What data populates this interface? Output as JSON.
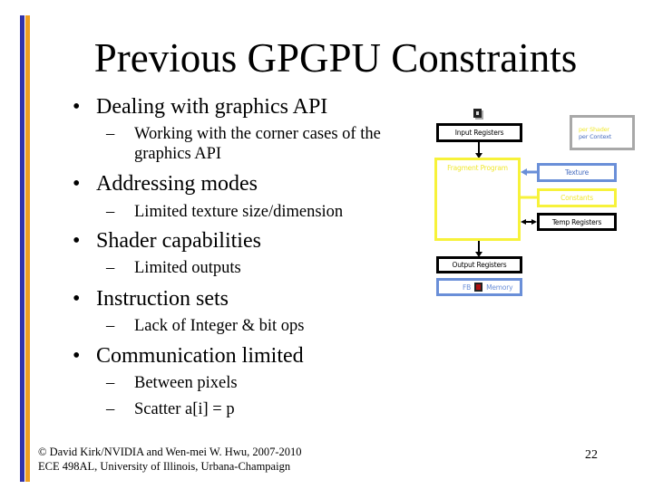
{
  "slide": {
    "title": "Previous GPGPU Constraints",
    "bullets": [
      {
        "text": "Dealing with graphics API",
        "sub": [
          "Working with the corner cases of the graphics API"
        ]
      },
      {
        "text": "Addressing modes",
        "sub": [
          "Limited texture size/dimension"
        ]
      },
      {
        "text": "Shader capabilities",
        "sub": [
          "Limited outputs"
        ]
      },
      {
        "text": "Instruction sets",
        "sub": [
          "Lack of Integer & bit ops"
        ]
      },
      {
        "text": "Communication limited",
        "sub": [
          "Between pixels",
          "Scatter  a[i] = p"
        ]
      }
    ],
    "bullet_glyph": "•",
    "dash_glyph": "–",
    "footer": {
      "line1": "© David Kirk/NVIDIA and Wen-mei W. Hwu, 2007-2010",
      "line2": "ECE 498AL, University of Illinois, Urbana-Champaign"
    },
    "page_number": "22"
  },
  "diagram": {
    "input_registers": "Input Registers",
    "fragment_program": "Fragment Program",
    "texture": "Texture",
    "constants": "Constants",
    "temp_registers": "Temp Registers",
    "output_registers": "Output Registers",
    "fb": "FB",
    "memory": "Memory",
    "legend": {
      "per_shader": "per Shader",
      "per_context": "per Context"
    },
    "colors": {
      "per_shader": "#f7f23a",
      "per_context": "#6a8fd8",
      "fixed": "#000000"
    }
  },
  "theme": {
    "bar_blue": "#3333aa",
    "bar_orange": "#f0a020"
  }
}
